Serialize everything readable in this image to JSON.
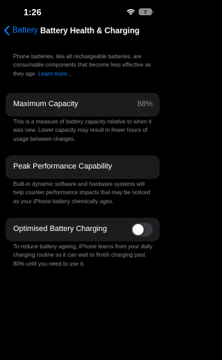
{
  "status_bar": {
    "time": "1:26",
    "battery_level": "7",
    "wifi_icon": "wifi-icon"
  },
  "nav": {
    "back_label": "Battery",
    "title": "Battery Health & Charging",
    "back_icon": "chevron-left-icon"
  },
  "intro": {
    "text": "Phone batteries, like all rechargeable batteries, are consumable components that become less effective as they age.",
    "link": "Learn more..."
  },
  "maximum_capacity": {
    "label": "Maximum Capacity",
    "value": "88%",
    "footnote": "This is a measure of battery capacity relative to when it was new. Lower capacity may result in fewer hours of usage between charges."
  },
  "peak_performance": {
    "label": "Peak Performance Capability",
    "footnote": "Built-in dynamic software and hardware systems will help counter performance impacts that may be noticed as your iPhone battery chemically ages."
  },
  "optimised_charging": {
    "label": "Optimised Battery Charging",
    "enabled": false,
    "footnote": "To reduce battery ageing, iPhone learns from your daily charging routine so it can wait to finish charging past 80% until you need to use it."
  },
  "colors": {
    "accent": "#0a84ff",
    "background": "#000000",
    "cell": "#1c1c1e",
    "secondary_text": "#8d8d92"
  }
}
